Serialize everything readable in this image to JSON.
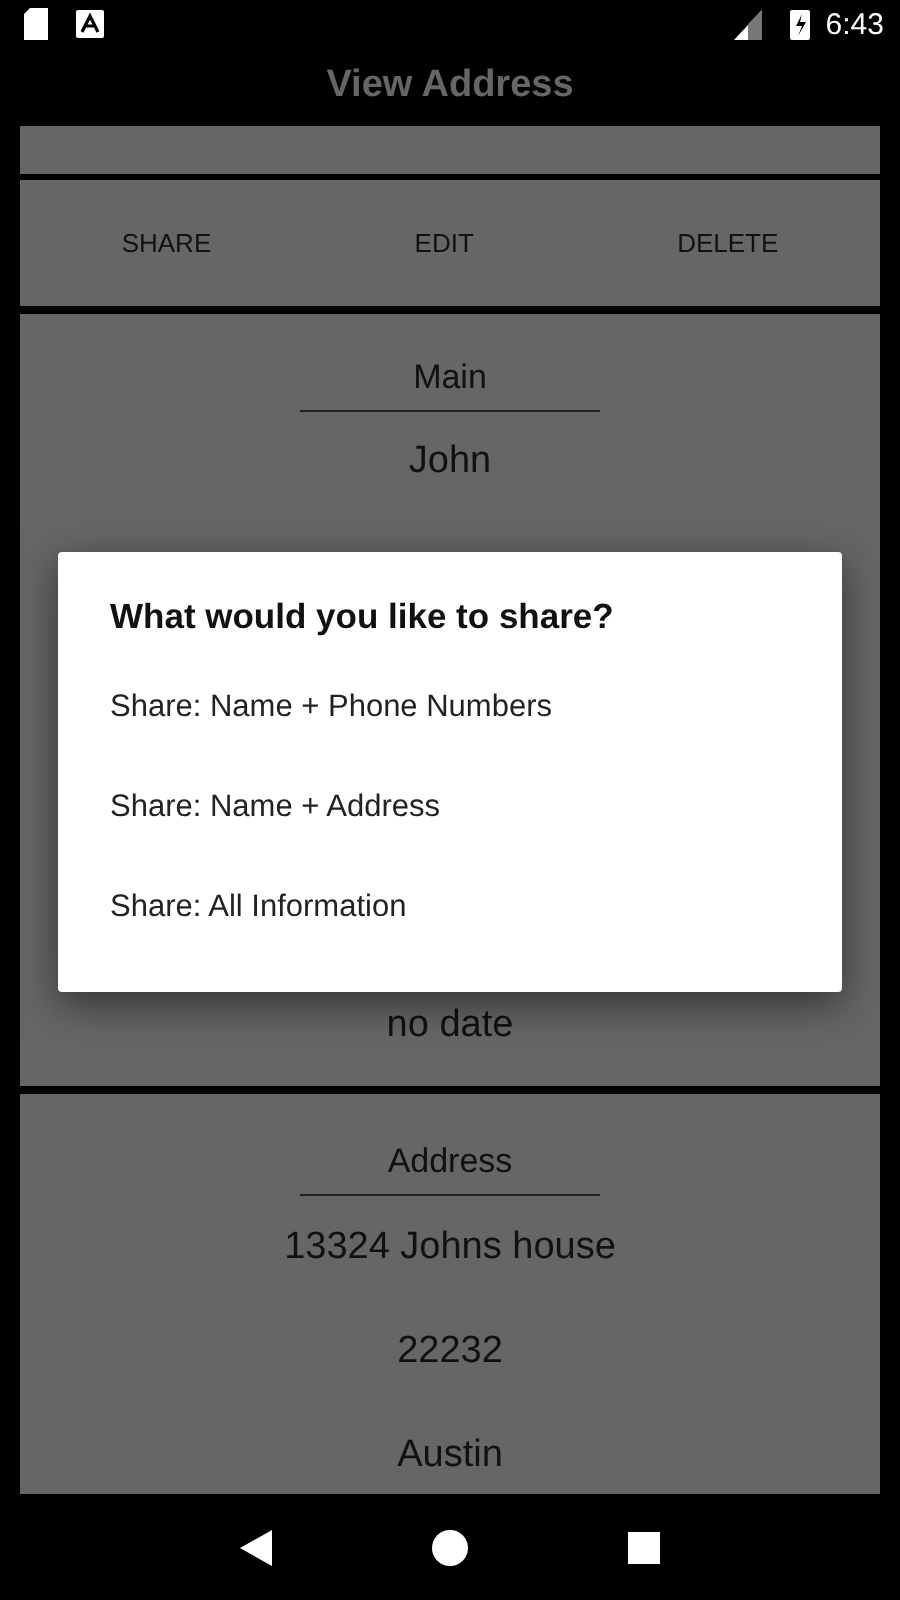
{
  "status_bar": {
    "time": "6:43"
  },
  "app_bar": {
    "title": "View Address"
  },
  "actions": [
    {
      "label": "SHARE"
    },
    {
      "label": "EDIT"
    },
    {
      "label": "DELETE"
    }
  ],
  "main_card": {
    "heading": "Main",
    "name": "John",
    "date": "no date"
  },
  "address_card": {
    "heading": "Address",
    "lines": [
      "13324 Johns house",
      "22232",
      "Austin"
    ]
  },
  "dialog": {
    "title": "What would you like to share?",
    "options": [
      {
        "label": "Share: Name + Phone Numbers"
      },
      {
        "label": "Share: Name + Address"
      },
      {
        "label": "Share: All Information"
      }
    ]
  }
}
